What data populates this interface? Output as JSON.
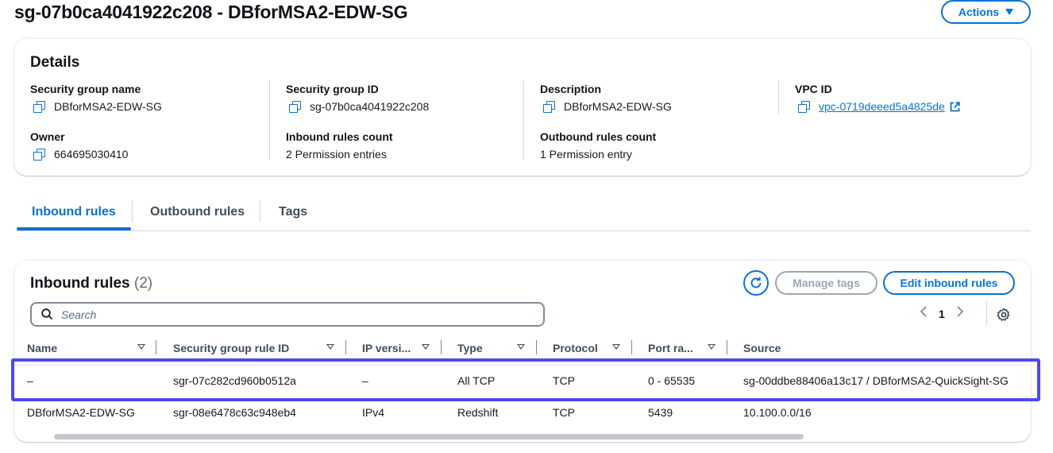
{
  "header": {
    "title": "sg-07b0ca4041922c208 - DBforMSA2-EDW-SG",
    "actions_label": "Actions"
  },
  "details": {
    "title": "Details",
    "fields": {
      "sg_name": {
        "label": "Security group name",
        "value": "DBforMSA2-EDW-SG"
      },
      "sg_id": {
        "label": "Security group ID",
        "value": "sg-07b0ca4041922c208"
      },
      "description": {
        "label": "Description",
        "value": "DBforMSA2-EDW-SG"
      },
      "vpc_id": {
        "label": "VPC ID",
        "value": "vpc-0719deeed5a4825de"
      },
      "owner": {
        "label": "Owner",
        "value": "664695030410"
      },
      "inbound_count": {
        "label": "Inbound rules count",
        "value": "2 Permission entries"
      },
      "outbound_count": {
        "label": "Outbound rules count",
        "value": "1 Permission entry"
      }
    }
  },
  "tabs": [
    {
      "label": "Inbound rules",
      "active": true
    },
    {
      "label": "Outbound rules",
      "active": false
    },
    {
      "label": "Tags",
      "active": false
    }
  ],
  "inbound": {
    "title": "Inbound rules",
    "count": "(2)",
    "manage_tags_label": "Manage tags",
    "edit_label": "Edit inbound rules",
    "search_placeholder": "Search",
    "page": "1",
    "columns": [
      "Name",
      "Security group rule ID",
      "IP versi...",
      "Type",
      "Protocol",
      "Port ra...",
      "Source"
    ],
    "rows": [
      {
        "name": "–",
        "rule_id": "sgr-07c282cd960b0512a",
        "ip_version": "–",
        "type": "All TCP",
        "protocol": "TCP",
        "port_range": "0 - 65535",
        "source": "sg-00ddbe88406a13c17 / DBforMSA2-QuickSight-SG"
      },
      {
        "name": "DBforMSA2-EDW-SG",
        "rule_id": "sgr-08e6478c63c948eb4",
        "ip_version": "IPv4",
        "type": "Redshift",
        "protocol": "TCP",
        "port_range": "5439",
        "source": "10.100.0.0/16"
      }
    ]
  },
  "colors": {
    "accent": "#0972d3",
    "highlight": "#4b4bef",
    "disabled": "#9ba7b6"
  }
}
